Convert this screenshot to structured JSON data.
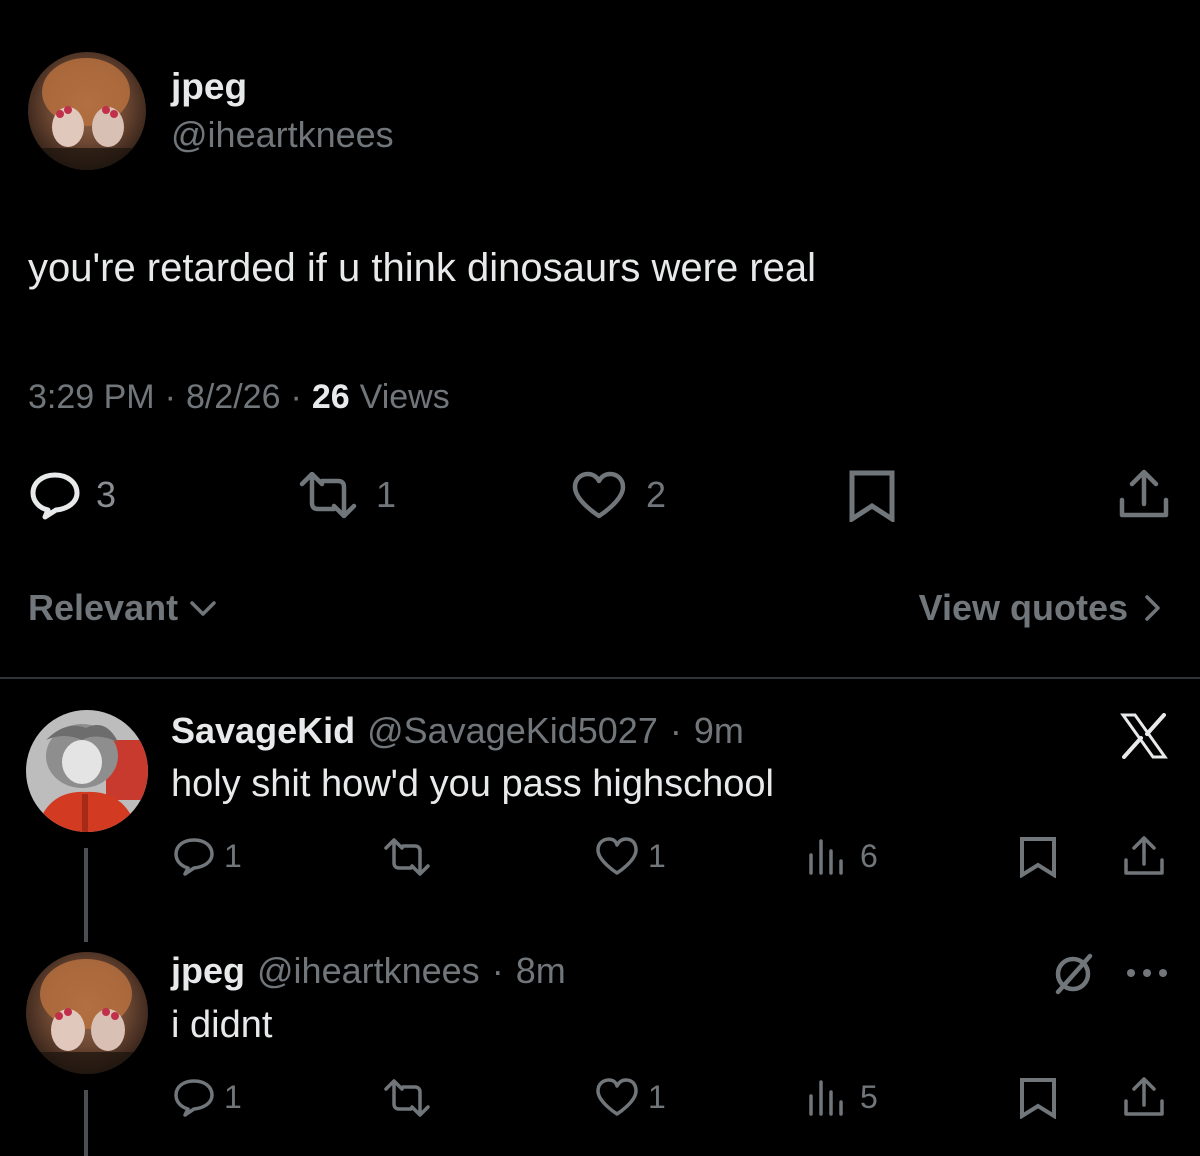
{
  "main_tweet": {
    "display_name": "jpeg",
    "handle": "@iheartknees",
    "text": "you're retarded if u think dinosaurs were real",
    "time": "3:29 PM",
    "date": "8/2/26",
    "views_count": "26",
    "views_label": "Views",
    "separator": "·",
    "reply_count": "3",
    "retweet_count": "1",
    "like_count": "2"
  },
  "sort_bar": {
    "relevant_label": "Relevant",
    "view_quotes_label": "View quotes"
  },
  "replies": [
    {
      "display_name": "SavageKid",
      "handle": "@SavageKid5027",
      "separator": "·",
      "time": "9m",
      "text": "holy shit how'd you pass highschool",
      "reply_count": "1",
      "like_count": "1",
      "view_count": "6"
    },
    {
      "display_name": "jpeg",
      "handle": "@iheartknees",
      "separator": "·",
      "time": "8m",
      "text": "i didnt",
      "reply_count": "1",
      "like_count": "1",
      "view_count": "5"
    }
  ],
  "icons": {
    "reply": "reply-icon",
    "retweet": "retweet-icon",
    "like": "heart-icon",
    "bookmark": "bookmark-icon",
    "share": "share-icon",
    "views": "views-icon",
    "x_logo": "x-logo-icon",
    "muted": "no-sign-icon",
    "more": "more-icon"
  },
  "colors": {
    "background": "#000000",
    "text_primary": "#e7e9ea",
    "text_secondary": "#71767b",
    "divider": "#2f3336"
  }
}
